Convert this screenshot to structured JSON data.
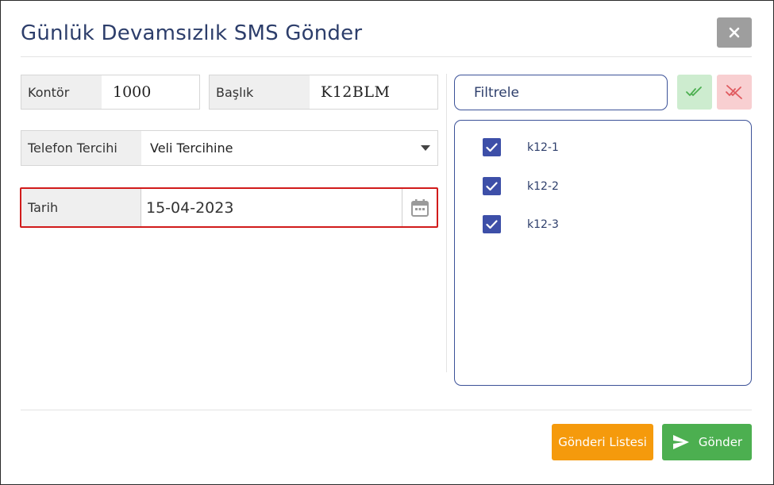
{
  "modal": {
    "title": "Günlük Devamsızlık SMS Gönder",
    "close_icon": "close-icon"
  },
  "form": {
    "kontor": {
      "label": "Kontör",
      "value": "1000"
    },
    "baslik": {
      "label": "Başlık",
      "value": "K12BLM"
    },
    "telefon": {
      "label": "Telefon Tercihi",
      "selected": "Veli Tercihine"
    },
    "tarih": {
      "label": "Tarih",
      "value": "15-04-2023",
      "icon": "calendar-icon"
    }
  },
  "filter": {
    "placeholder": "Filtrele",
    "select_all_icon": "double-check-icon",
    "deselect_all_icon": "double-check-off-icon"
  },
  "classes": [
    {
      "label": "k12-1",
      "checked": true
    },
    {
      "label": "k12-2",
      "checked": true
    },
    {
      "label": "k12-3",
      "checked": true
    }
  ],
  "footer": {
    "list_button": "Gönderi Listesi",
    "send_button": "Gönder",
    "send_icon": "send-icon"
  },
  "colors": {
    "title": "#2d3e6b",
    "highlight_border": "#d11b1b",
    "list_button": "#f59a0c",
    "send_button": "#4caf50",
    "checkbox": "#3d4fa8"
  }
}
